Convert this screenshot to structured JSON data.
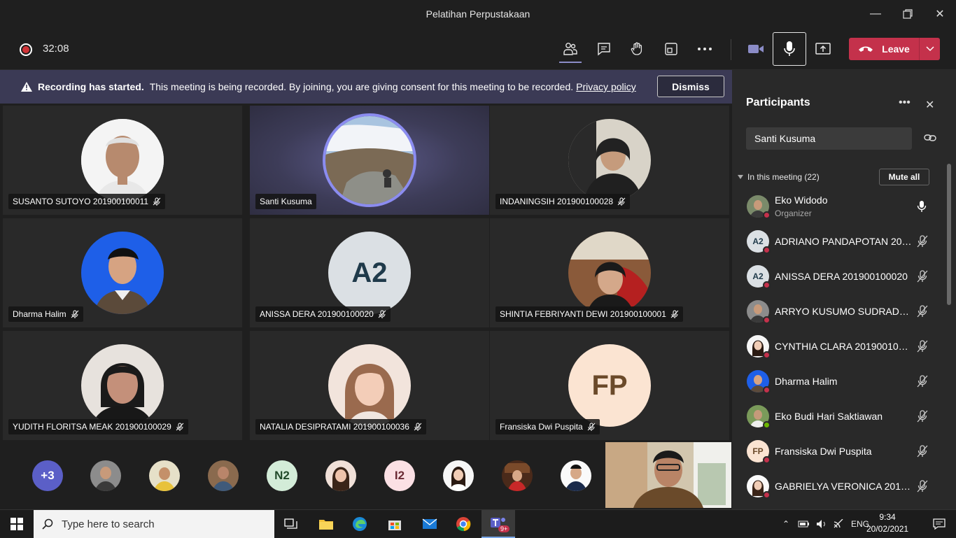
{
  "window": {
    "title": "Pelatihan Perpustakaan"
  },
  "toolbar": {
    "timer": "32:08",
    "leave_label": "Leave"
  },
  "banner": {
    "bold": "Recording has started.",
    "text": "This meeting is being recorded. By joining, you are giving consent for this meeting to be recorded.",
    "link": "Privacy policy",
    "dismiss": "Dismiss"
  },
  "tiles": [
    {
      "name": "SUSANTO SUTOYO 201900100011"
    },
    {
      "name": "Santi Kusuma"
    },
    {
      "name": "INDANINGSIH 201900100028"
    },
    {
      "name": "Dharma Halim"
    },
    {
      "name": "ANISSA DERA 201900100020",
      "initials": "A2"
    },
    {
      "name": "SHINTIA FEBRIYANTI DEWI 201900100001"
    },
    {
      "name": "YUDITH FLORITSA MEAK 201900100029"
    },
    {
      "name": "NATALIA DESIPRATAMI 201900100036"
    },
    {
      "name": "Fransiska Dwi Puspita",
      "initials": "FP"
    }
  ],
  "strip": {
    "overflow": "+3",
    "n2": "N2",
    "i2": "I2"
  },
  "panel": {
    "title": "Participants",
    "search_value": "Santi Kusuma",
    "section": "In this meeting (22)",
    "mute_all": "Mute all",
    "participants": [
      {
        "name": "Eko Widodo",
        "role": "Organizer"
      },
      {
        "name": "ADRIANO PANDAPOTAN 201...",
        "initials": "A2"
      },
      {
        "name": "ANISSA DERA 201900100020",
        "initials": "A2"
      },
      {
        "name": "ARRYO KUSUMO SUDRADJAT..."
      },
      {
        "name": "CYNTHIA CLARA 2019001000..."
      },
      {
        "name": "Dharma Halim"
      },
      {
        "name": "Eko Budi Hari Saktiawan"
      },
      {
        "name": "Fransiska Dwi Puspita",
        "initials": "FP"
      },
      {
        "name": "GABRIELYA VERONICA 20190..."
      }
    ]
  },
  "taskbar": {
    "search_placeholder": "Type here to search",
    "teams_badge": "9+",
    "lang": "ENG",
    "time": "9:34",
    "date": "20/02/2021"
  }
}
